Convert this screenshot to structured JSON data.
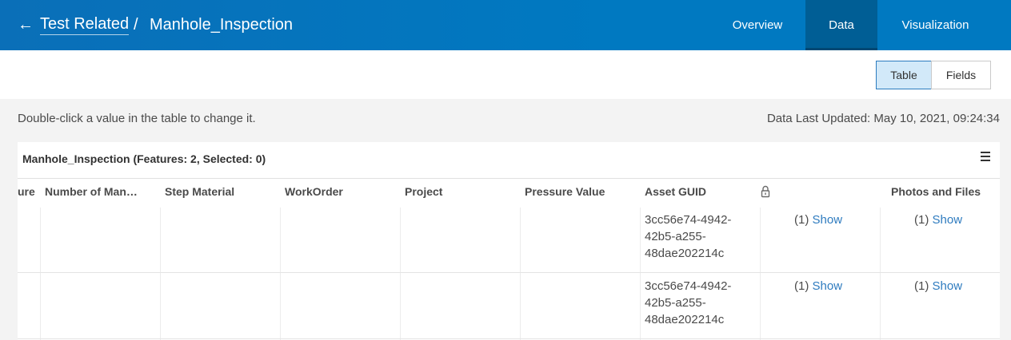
{
  "header": {
    "back_label": "Test Related",
    "separator": "/",
    "title": "Manhole_Inspection",
    "tabs": {
      "overview": "Overview",
      "data": "Data",
      "visualization": "Visualization"
    },
    "active_tab": "Data"
  },
  "toolbar": {
    "table_label": "Table",
    "fields_label": "Fields",
    "active": "Table"
  },
  "info": {
    "hint": "Double-click a value in the table to change it.",
    "last_updated": "Data Last Updated: May 10, 2021, 09:24:34"
  },
  "table": {
    "title": "Manhole_Inspection (Features: 2, Selected: 0)",
    "columns": {
      "c0": "ure",
      "c1": "Number of Man…",
      "c2": "Step Material",
      "c3": "WorkOrder",
      "c4": "Project",
      "c5": "Pressure Value",
      "c6": "Asset GUID",
      "c8": "Photos and Files"
    },
    "rows": [
      {
        "guid_l1": "3cc56e74-4942-",
        "guid_l2": "42b5-a255-",
        "guid_l3": "48dae202214c",
        "att_count": "(1)",
        "att_link": "Show",
        "photo_count": "(1)",
        "photo_link": "Show"
      },
      {
        "guid_l1": "3cc56e74-4942-",
        "guid_l2": "42b5-a255-",
        "guid_l3": "48dae202214c",
        "att_count": "(1)",
        "att_link": "Show",
        "photo_count": "(1)",
        "photo_link": "Show"
      }
    ]
  },
  "colors": {
    "header_blue": "#0079c1",
    "active_tab": "#005e95",
    "link": "#2e7bbf"
  },
  "icons": [
    "back-arrow-icon",
    "hamburger-menu-icon",
    "lock-icon"
  ]
}
